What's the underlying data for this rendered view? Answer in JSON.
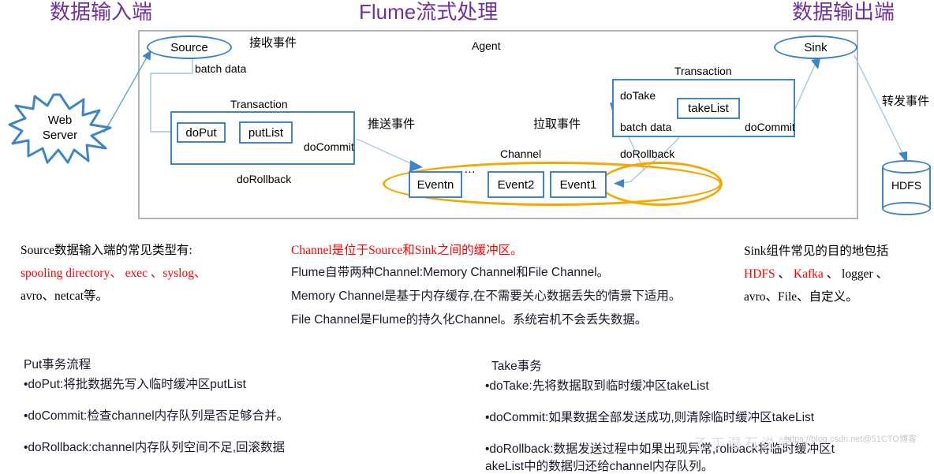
{
  "titles": {
    "left": "数据输入端",
    "center": "Flume流式处理",
    "right": "数据输出端",
    "color": "#7030A0"
  },
  "diagram": {
    "agent_label": "Agent",
    "source_label": "Source",
    "sink_label": "Sink",
    "web_server_line1": "Web",
    "web_server_line2": "Server",
    "hdfs_label": "HDFS",
    "recv_event": "接收事件",
    "batch_data_left": "batch data",
    "push_event": "推送事件",
    "pull_event": "拉取事件",
    "forward_event": "转发事件",
    "channel_label": "Channel",
    "transaction_left_label": "Transaction",
    "transaction_right_label": "Transaction",
    "do_put": "doPut",
    "put_list": "putList",
    "do_commit_left": "doCommit",
    "do_rollback_left": "doRollback",
    "do_take": "doTake",
    "take_list": "takeList",
    "batch_data_right": "batch data",
    "do_commit_right": "doCommit",
    "do_rollback_right": "doRollback",
    "event_n": "Eventn",
    "event_2": "Event2",
    "event_1": "Event1",
    "event_dots": "…",
    "colors": {
      "blue": "#3d85c8",
      "orange": "#f5a800",
      "frame": "#b3b3b3"
    }
  },
  "source_note": {
    "line1": "Source数据输入端的常见类型有:",
    "line2": "spooling directory、 exec 、syslog、",
    "line3": "avro、netcat等。"
  },
  "channel_note": {
    "line1": "Channel是位于Source和Sink之间的缓冲区。",
    "line2": "Flume自带两种Channel:Memory Channel和File Channel。",
    "line3": "Memory Channel是基于内存缓存,在不需要关心数据丢失的情景下适用。",
    "line4": "File Channel是Flume的持久化Channel。系统宕机不会丢失数据。"
  },
  "sink_note": {
    "line1": "Sink组件常见的目的地包括",
    "line2_red_a": "HDFS",
    "line2_sep1": " 、 ",
    "line2_red_b": "Kafka",
    "line2_sep2": " 、 ",
    "line2_black": "logger 、",
    "line3": "avro、File、自定义。"
  },
  "put_flow": {
    "heading": "Put事务流程",
    "items": [
      "•doPut:将批数据先写入临时缓冲区putList",
      "•doCommit:检查channel内存队列是否足够合并。",
      "•doRollback:channel内存队列空间不足,回滚数据"
    ]
  },
  "take_flow": {
    "heading": "Take事务",
    "items": [
      "•doTake:先将数据取到临时缓冲区takeList",
      "•doCommit:如果数据全部发送成功,则清除临时缓冲区takeList",
      "•doRollback:数据发送过程中如果出现异常,rollback将临时缓冲区t",
      "akeList中的数据归还给channel内存队列。"
    ]
  },
  "watermark": {
    "text": "https://blog.csdn.net@51CTO博客",
    "calligraphy": "乙 丁 湿 石 说 学"
  }
}
